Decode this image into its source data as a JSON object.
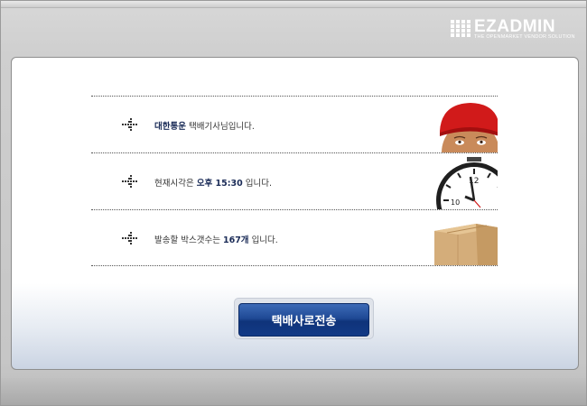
{
  "logo": {
    "name": "EZADMIN",
    "tagline": "THE OPENMARKET VENDOR SOLUTION"
  },
  "rows": [
    {
      "strong": "대한통운",
      "text": " 택배기사님입니다.",
      "image": "courier-face-image"
    },
    {
      "prefix": "현재시각은 ",
      "strong": "오후  15:30",
      "text": " 입니다.",
      "image": "clock-image"
    },
    {
      "prefix": "발송할 박스갯수는 ",
      "strong": "167개",
      "text": " 입니다.",
      "image": "box-image"
    }
  ],
  "send_button": {
    "label": "택배사로전송"
  },
  "colors": {
    "accent": "#1f4a96",
    "strong_text": "#1a2b57"
  }
}
